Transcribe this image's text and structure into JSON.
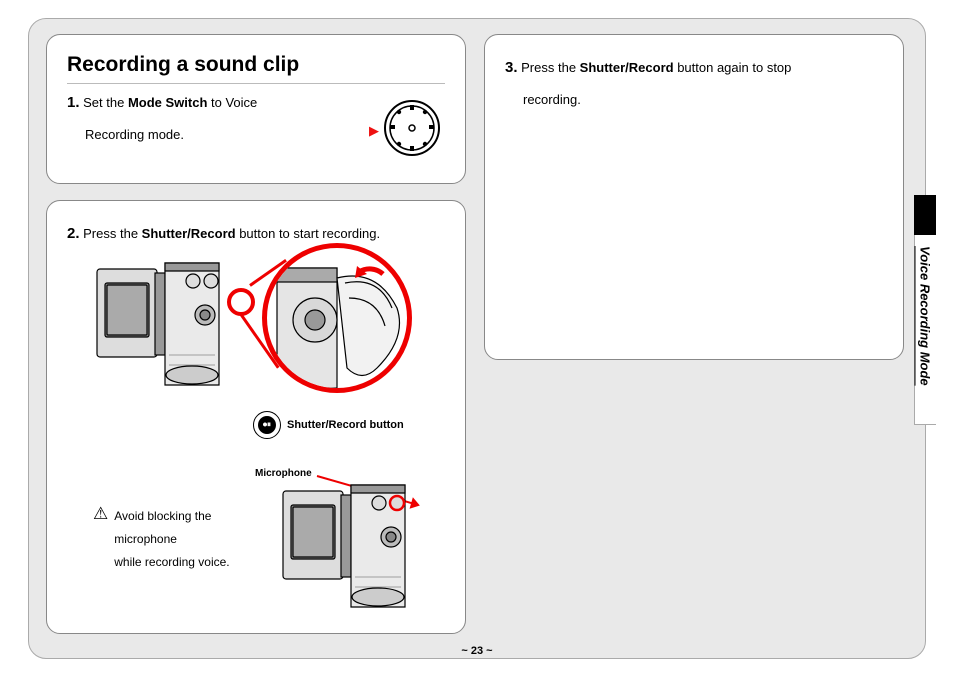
{
  "title": "Recording a sound clip",
  "section_tab": "Voice Recording Mode",
  "page_number": "~ 23 ~",
  "steps": {
    "s1": {
      "num": "1.",
      "pre": "Set the ",
      "bold": "Mode Switch",
      "post": " to Voice",
      "line2": "Recording mode."
    },
    "s2": {
      "num": "2.",
      "pre": "Press the ",
      "bold": "Shutter/Record",
      "post": " button to start recording."
    },
    "s3": {
      "num": "3.",
      "pre": "Press the ",
      "bold": "Shutter/Record",
      "post": " button again to stop",
      "line2": "recording."
    }
  },
  "labels": {
    "shutter_button": "Shutter/Record button",
    "microphone": "Microphone"
  },
  "warning": {
    "line1": "Avoid blocking the microphone",
    "line2": "while recording voice."
  },
  "icons": {
    "red_arrow": "▶",
    "warn": "⚠",
    "round_btn": "⏺⏸"
  }
}
